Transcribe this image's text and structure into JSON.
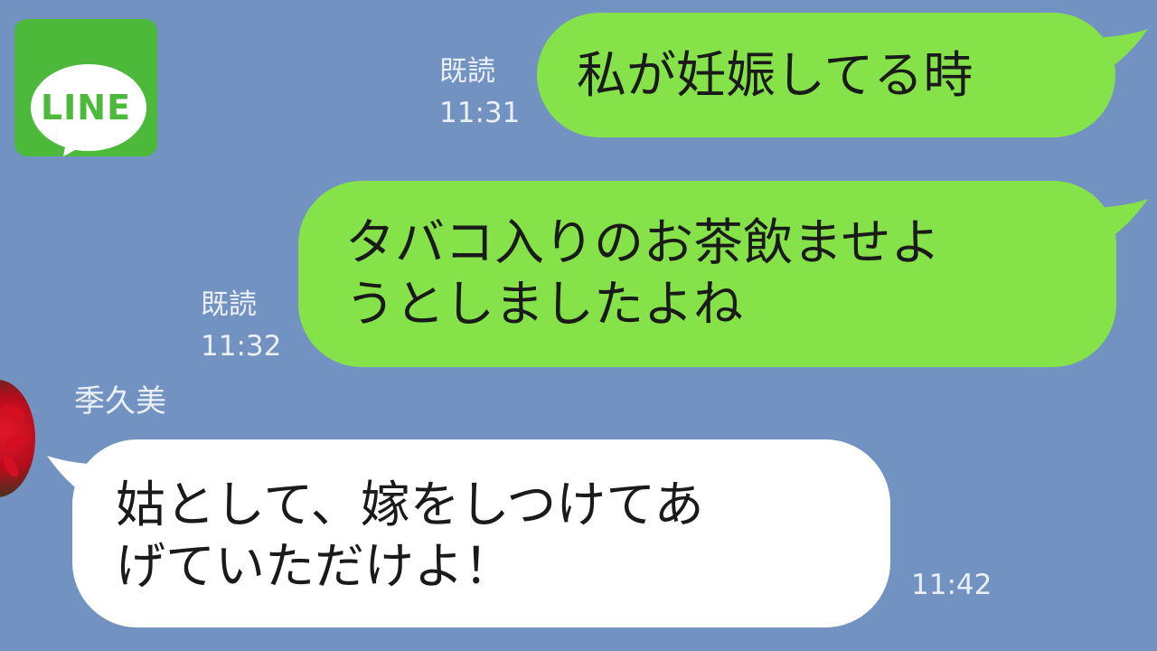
{
  "app": {
    "logo_text": "LINE",
    "colors": {
      "background": "#7292c1",
      "sent_bubble": "#85e249",
      "received_bubble": "#ffffff",
      "logo_green": "#4cb93b",
      "meta_text": "#ebf0f8"
    }
  },
  "messages": [
    {
      "direction": "sent",
      "read_label": "既読",
      "time": "11:31",
      "lines": [
        "私が妊娠してる時"
      ]
    },
    {
      "direction": "sent",
      "read_label": "既読",
      "time": "11:32",
      "lines": [
        "タバコ入りのお茶飲ませよ",
        "うとしましたよね"
      ]
    },
    {
      "direction": "received",
      "sender": "季久美",
      "time": "11:42",
      "lines": [
        "姑として、嫁をしつけてあ",
        "げていただけよ！"
      ]
    }
  ]
}
